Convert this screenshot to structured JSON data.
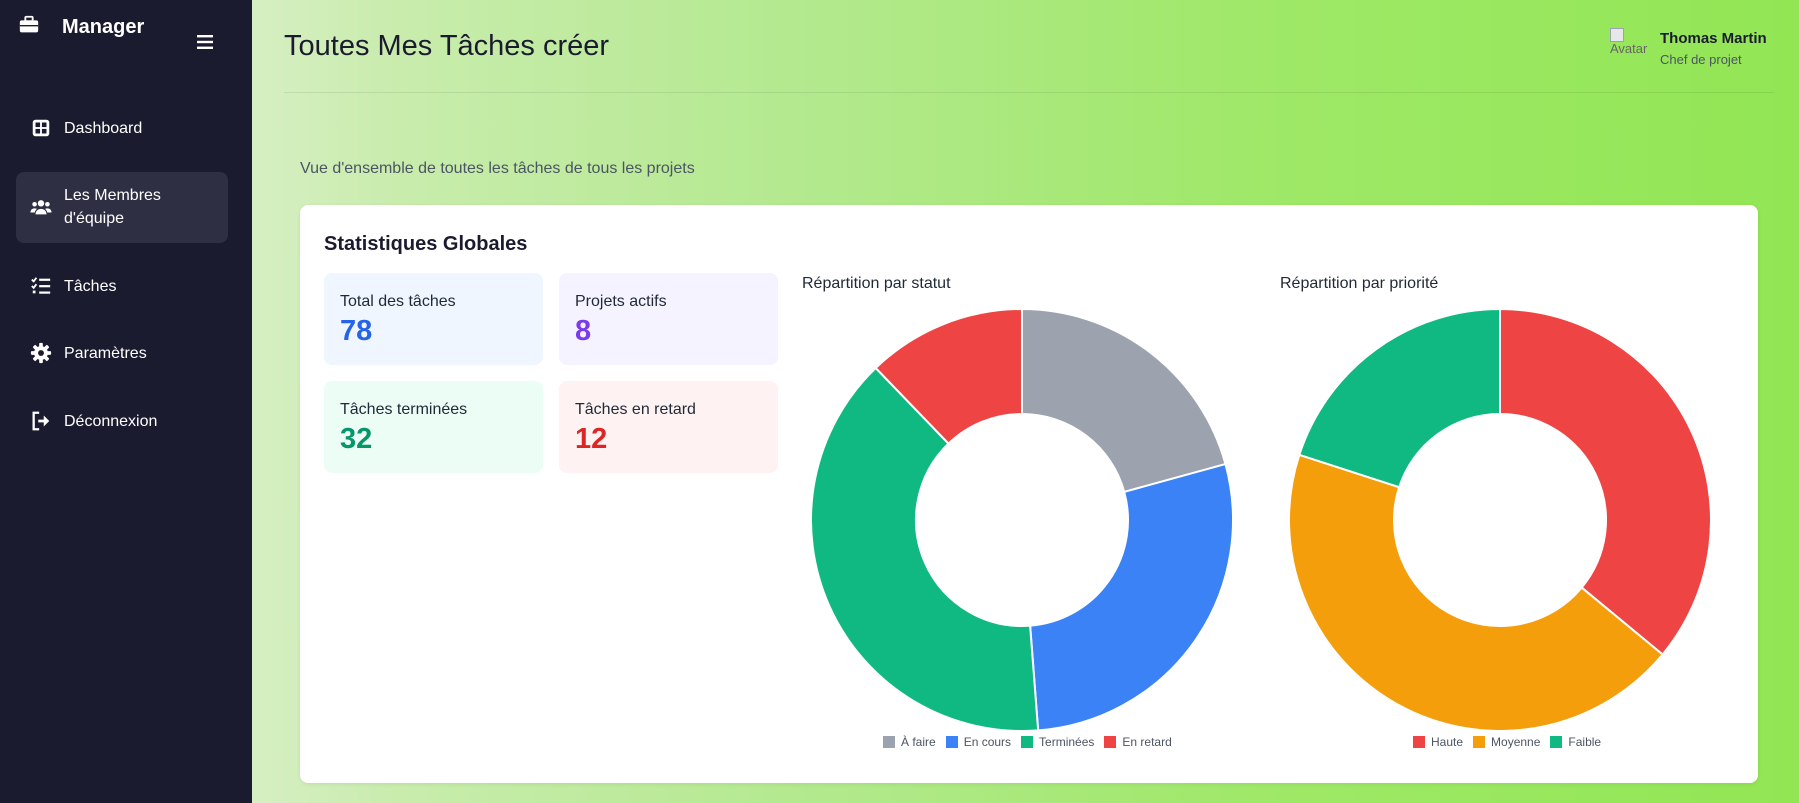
{
  "sidebar": {
    "brand": "Manager",
    "items": [
      {
        "label": "Dashboard",
        "icon": "grid-icon"
      },
      {
        "label_line1": "Les Membres",
        "label_line2": "d'équipe",
        "icon": "users-icon",
        "active": true
      },
      {
        "label": "Tâches",
        "icon": "checklist-icon"
      },
      {
        "label": "Paramètres",
        "icon": "gear-icon"
      },
      {
        "label": "Déconnexion",
        "icon": "logout-icon"
      }
    ]
  },
  "header": {
    "title": "Toutes Mes Tâches créer",
    "user": {
      "name": "Thomas Martin",
      "role": "Chef de projet",
      "avatar_alt": "Avatar"
    }
  },
  "main": {
    "subtitle": "Vue d'ensemble de toutes les tâches de tous les projets",
    "card_title": "Statistiques Globales",
    "stats": [
      {
        "label": "Total des tâches",
        "value": "78",
        "color": "#2563eb",
        "bg": "#eff6ff"
      },
      {
        "label": "Projets actifs",
        "value": "8",
        "color": "#7c3aed",
        "bg": "#f5f3ff"
      },
      {
        "label": "Tâches terminées",
        "value": "32",
        "color": "#059669",
        "bg": "#ecfdf5"
      },
      {
        "label": "Tâches en retard",
        "value": "12",
        "color": "#dc2626",
        "bg": "#fef2f2"
      }
    ]
  },
  "colors": {
    "sidebar_bg": "#1b1b2f",
    "active_item": "#2f2f44"
  },
  "chart_data": [
    {
      "type": "pie",
      "title": "Répartition par statut",
      "categories": [
        "À faire",
        "En cours",
        "Terminées",
        "En retard"
      ],
      "values": [
        17,
        23,
        32,
        10
      ],
      "colors": [
        "#9ca3af",
        "#3b82f6",
        "#10b981",
        "#ef4444"
      ],
      "legend": "bottom"
    },
    {
      "type": "pie",
      "title": "Répartition par priorité",
      "categories": [
        "Haute",
        "Moyenne",
        "Faible"
      ],
      "values": [
        36,
        44,
        20
      ],
      "colors": [
        "#ef4444",
        "#f59e0b",
        "#10b981"
      ],
      "legend": "bottom"
    }
  ]
}
